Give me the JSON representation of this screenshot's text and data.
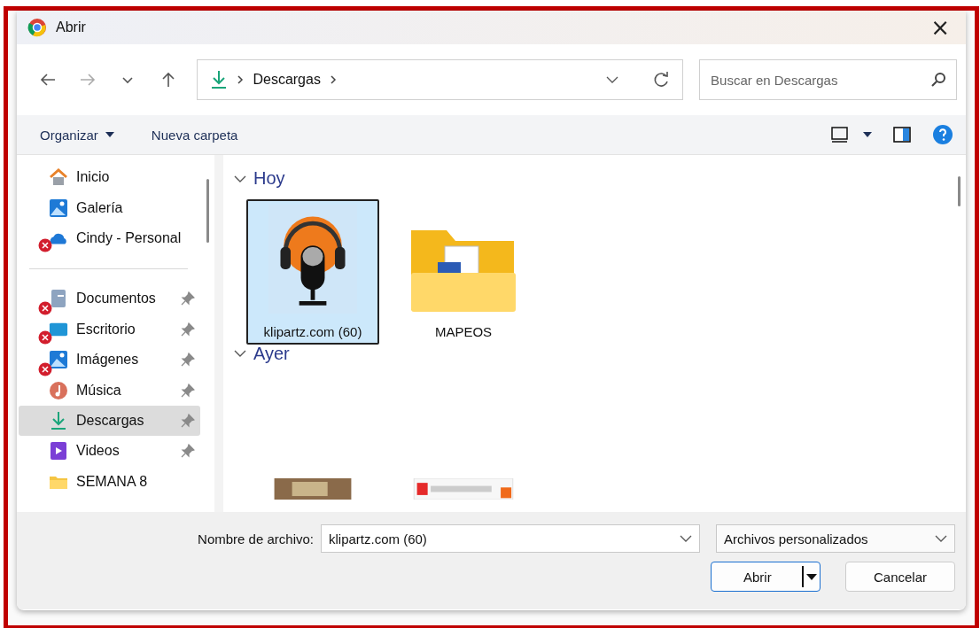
{
  "window": {
    "title": "Abrir",
    "close": "×"
  },
  "address": {
    "path": [
      "Descargas"
    ]
  },
  "search": {
    "placeholder": "Buscar en Descargas"
  },
  "toolbar": {
    "organize": "Organizar",
    "new_folder": "Nueva carpeta"
  },
  "sidebar": {
    "items": [
      {
        "label": "Inicio",
        "kind": "home",
        "pinned": false,
        "error": false,
        "selected": false
      },
      {
        "label": "Galería",
        "kind": "gallery",
        "pinned": false,
        "error": false,
        "selected": false
      },
      {
        "label": "Cindy - Personal",
        "kind": "cloud",
        "pinned": false,
        "error": true,
        "selected": false
      },
      {
        "kind": "divider"
      },
      {
        "label": "Documentos",
        "kind": "docs",
        "pinned": true,
        "error": true,
        "selected": false
      },
      {
        "label": "Escritorio",
        "kind": "desktop",
        "pinned": true,
        "error": true,
        "selected": false
      },
      {
        "label": "Imágenes",
        "kind": "gallery",
        "pinned": true,
        "error": true,
        "selected": false
      },
      {
        "label": "Música",
        "kind": "music",
        "pinned": true,
        "error": false,
        "selected": false
      },
      {
        "label": "Descargas",
        "kind": "download",
        "pinned": true,
        "error": false,
        "selected": true
      },
      {
        "label": "Videos",
        "kind": "video",
        "pinned": true,
        "error": false,
        "selected": false
      },
      {
        "label": "SEMANA 8",
        "kind": "folder",
        "pinned": false,
        "error": false,
        "selected": false
      }
    ]
  },
  "groups": [
    {
      "title": "Hoy",
      "expanded": true,
      "items": [
        {
          "label": "klipartz.com (60)",
          "kind": "podcast",
          "selected": true
        },
        {
          "label": "MAPEOS",
          "kind": "folder",
          "selected": false
        }
      ]
    },
    {
      "title": "Ayer",
      "expanded": true,
      "items": [
        {
          "kind": "photo",
          "selected": false
        },
        {
          "kind": "banner",
          "selected": false
        }
      ]
    }
  ],
  "footer": {
    "filename_label": "Nombre de archivo:",
    "filename": "klipartz.com (60)",
    "filter": "Archivos personalizados",
    "open": "Abrir",
    "cancel": "Cancelar"
  }
}
